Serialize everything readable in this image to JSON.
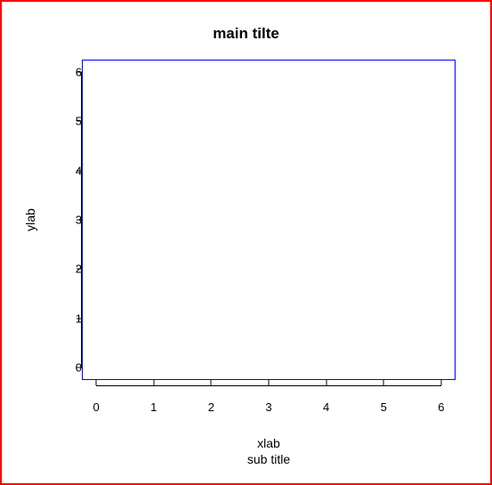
{
  "chart_data": {
    "type": "scatter",
    "title": "main tilte",
    "subtitle": "sub title",
    "xlabel": "xlab",
    "ylabel": "ylab",
    "xlim": [
      -0.25,
      6.25
    ],
    "ylim": [
      -0.25,
      6.25
    ],
    "x_ticks": [
      0,
      1,
      2,
      3,
      4,
      5,
      6
    ],
    "y_ticks": [
      0,
      1,
      2,
      3,
      4,
      5,
      6
    ],
    "series": []
  }
}
